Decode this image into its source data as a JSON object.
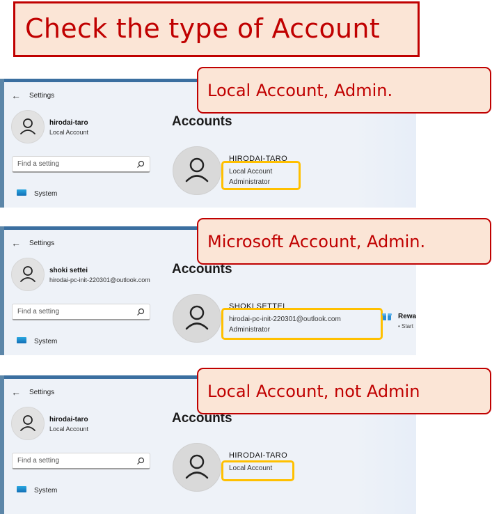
{
  "title": "Check the type of Account",
  "settings": {
    "app_title": "Settings",
    "search_placeholder": "Find a setting",
    "system_label": "System",
    "accounts_heading": "Accounts"
  },
  "panels": [
    {
      "user_name": "hirodai-taro",
      "user_sub": "Local Account",
      "account_name": "HIRODAI-TARO",
      "account_line1": "Local Account",
      "account_line2": "Administrator",
      "callout": "Local Account, Admin."
    },
    {
      "user_name": "shoki settei",
      "user_sub": "hirodai-pc-init-220301@outlook.com",
      "account_name": "SHOKI SETTEI",
      "account_line1": "hirodai-pc-init-220301@outlook.com",
      "account_line2": "Administrator",
      "callout": "Microsoft Account, Admin.",
      "rewards_title": "Rewa",
      "rewards_sub": "• Start"
    },
    {
      "user_name": "hirodai-taro",
      "user_sub": "Local Account",
      "account_name": "HIRODAI-TARO",
      "account_line1": "Local Account",
      "account_line2": "",
      "callout": "Local Account, not Admin"
    }
  ],
  "colors": {
    "callout_border": "#c00000",
    "callout_fill": "#fbe5d6",
    "highlight": "#ffc000"
  }
}
